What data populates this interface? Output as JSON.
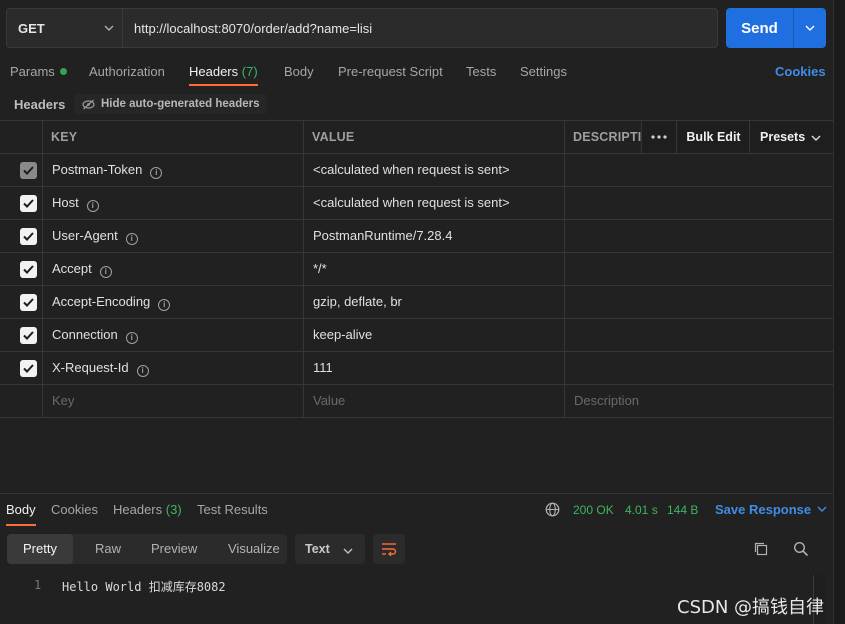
{
  "request": {
    "method": "GET",
    "url": "http://localhost:8070/order/add?name=lisi",
    "send_label": "Send"
  },
  "tabs": {
    "params": "Params",
    "authorization": "Authorization",
    "headers": "Headers",
    "headers_count": "(7)",
    "body": "Body",
    "prerequest": "Pre-request Script",
    "tests": "Tests",
    "settings": "Settings",
    "cookies": "Cookies"
  },
  "headers_section": {
    "title": "Headers",
    "hide_auto": "Hide auto-generated headers"
  },
  "table": {
    "col_key": "KEY",
    "col_value": "VALUE",
    "col_description": "DESCRIPTIO",
    "bulk_edit": "Bulk Edit",
    "presets": "Presets",
    "rows": [
      {
        "key": "Postman-Token",
        "value": "<calculated when request is sent>",
        "checked": true,
        "disabled": true
      },
      {
        "key": "Host",
        "value": "<calculated when request is sent>",
        "checked": true,
        "disabled": false
      },
      {
        "key": "User-Agent",
        "value": "PostmanRuntime/7.28.4",
        "checked": true,
        "disabled": false
      },
      {
        "key": "Accept",
        "value": "*/*",
        "checked": true,
        "disabled": false
      },
      {
        "key": "Accept-Encoding",
        "value": "gzip, deflate, br",
        "checked": true,
        "disabled": false
      },
      {
        "key": "Connection",
        "value": "keep-alive",
        "checked": true,
        "disabled": false
      },
      {
        "key": "X-Request-Id",
        "value": "111",
        "checked": true,
        "disabled": false
      }
    ],
    "placeholder_key": "Key",
    "placeholder_value": "Value",
    "placeholder_description": "Description"
  },
  "response": {
    "tabs": {
      "body": "Body",
      "cookies": "Cookies",
      "headers": "Headers",
      "headers_count": "(3)",
      "test_results": "Test Results"
    },
    "status": "200 OK",
    "time": "4.01 s",
    "size": "144 B",
    "save_response": "Save Response",
    "views": [
      "Pretty",
      "Raw",
      "Preview",
      "Visualize"
    ],
    "format": "Text",
    "lines": [
      {
        "num": "1",
        "text": "Hello World 扣减库存8082"
      }
    ]
  },
  "watermark": "CSDN @搞钱自律",
  "colors": {
    "accent": "#ff6c37",
    "send": "#1f6fe0",
    "link": "#3f8de8",
    "success": "#3eb55e"
  }
}
